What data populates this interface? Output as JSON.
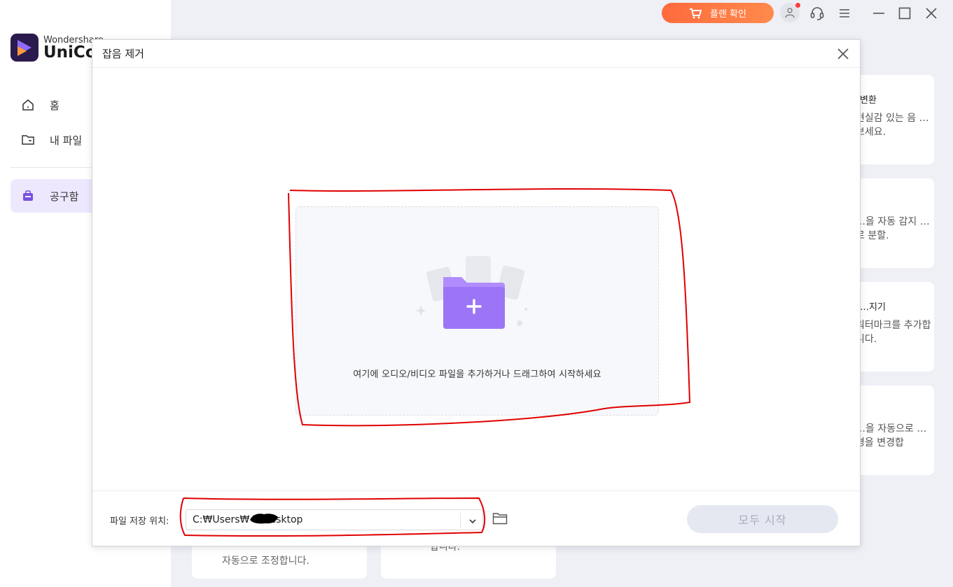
{
  "sidebar": {
    "brand_small": "Wondershare",
    "brand_big": "UniCo",
    "items": [
      {
        "label": "홈",
        "icon": "home-icon"
      },
      {
        "label": "내 파일",
        "icon": "folder-icon"
      },
      {
        "label": "공구함",
        "icon": "toolbox-icon",
        "active": true
      }
    ]
  },
  "topbar": {
    "plan_label": "플랜 확인"
  },
  "cards": [
    {
      "title": "변환",
      "desc": "현실감 있는 음 …보세요."
    },
    {
      "title": "",
      "desc": "…을 자동 감지 …로 분할."
    },
    {
      "title": "…지기",
      "desc": "워터마크를 추가합니다."
    },
    {
      "title": "",
      "desc": "…을 자동으로 …경을 변경합"
    }
  ],
  "bottom_cards": [
    {
      "desc": "자동으로 조정합니다."
    },
    {
      "desc": "합니다."
    }
  ],
  "modal": {
    "title": "잡음 제거",
    "dropzone_text": "여기에 오디오/비디오 파일을 추가하거나 드래그하여 시작하세요",
    "save_location_label": "파일 저장 위치:",
    "save_path": "C:₩Users₩        ₩Desktop",
    "start_all_label": "모두 시작"
  },
  "colors": {
    "accent": "#8f6bff",
    "plan_button": "#ff6a3d",
    "annotation": "#e00000"
  }
}
